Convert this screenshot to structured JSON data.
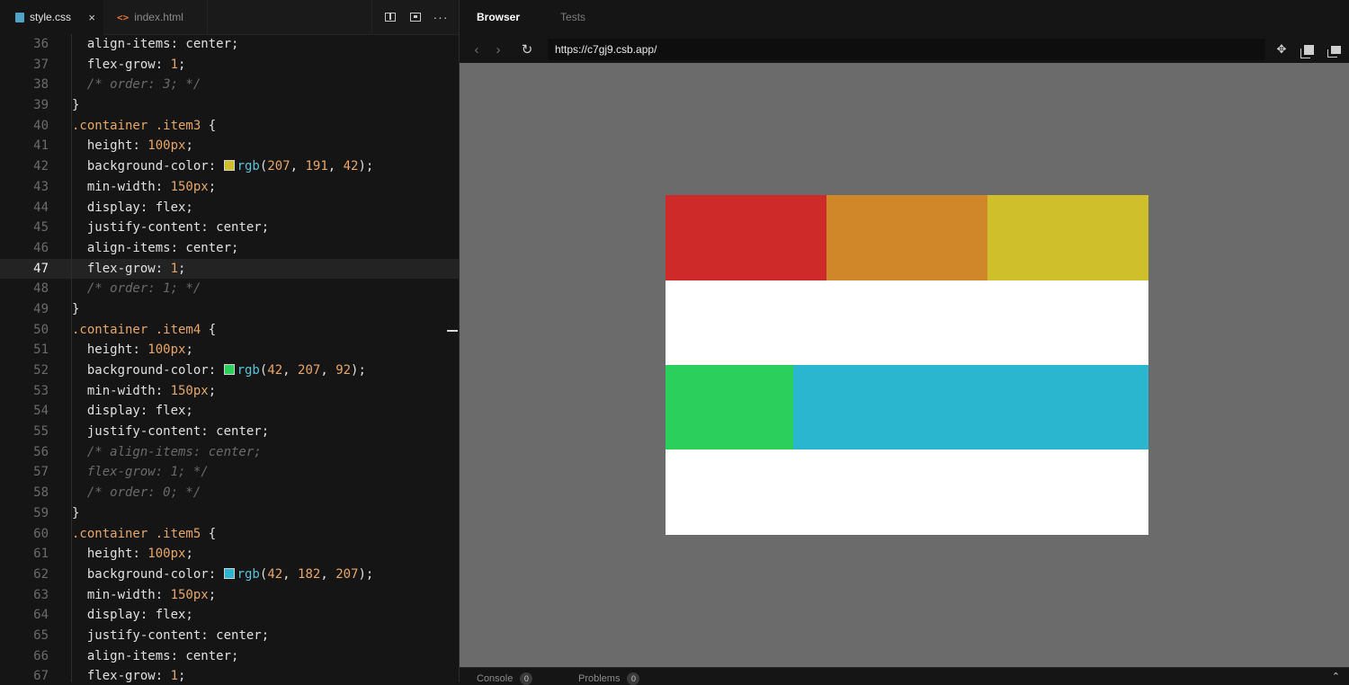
{
  "editor": {
    "tabs": [
      {
        "label": "style.css",
        "active": true,
        "icon": "css-file-icon"
      },
      {
        "label": "index.html",
        "active": false,
        "icon": "html-file-icon"
      }
    ],
    "close_glyph": "×",
    "html_icon_glyph": "<>",
    "more_glyph": "···",
    "current_line": 47,
    "lines": [
      {
        "n": "36",
        "segs": [
          [
            "p",
            "  align-items"
          ],
          [
            "k",
            ": center;"
          ]
        ]
      },
      {
        "n": "37",
        "segs": [
          [
            "p",
            "  flex-grow"
          ],
          [
            "k",
            ": "
          ],
          [
            "n",
            "1"
          ],
          [
            "k",
            ";"
          ]
        ]
      },
      {
        "n": "38",
        "segs": [
          [
            "c",
            "  /* order: 3; */"
          ]
        ]
      },
      {
        "n": "39",
        "segs": [
          [
            "k",
            "}"
          ]
        ]
      },
      {
        "n": "40",
        "segs": [
          [
            "s",
            ".container .item3"
          ],
          [
            "k",
            " {"
          ]
        ]
      },
      {
        "n": "41",
        "segs": [
          [
            "p",
            "  height"
          ],
          [
            "k",
            ": "
          ],
          [
            "n",
            "100px"
          ],
          [
            "k",
            ";"
          ]
        ]
      },
      {
        "n": "42",
        "segs": [
          [
            "p",
            "  background-color"
          ],
          [
            "k",
            ": "
          ],
          [
            "sw",
            "#cfbf2a"
          ],
          [
            "f",
            "rgb"
          ],
          [
            "k",
            "("
          ],
          [
            "n",
            "207"
          ],
          [
            "k",
            ", "
          ],
          [
            "n",
            "191"
          ],
          [
            "k",
            ", "
          ],
          [
            "n",
            "42"
          ],
          [
            "k",
            ");"
          ]
        ]
      },
      {
        "n": "43",
        "segs": [
          [
            "p",
            "  min-width"
          ],
          [
            "k",
            ": "
          ],
          [
            "n",
            "150px"
          ],
          [
            "k",
            ";"
          ]
        ]
      },
      {
        "n": "44",
        "segs": [
          [
            "p",
            "  display"
          ],
          [
            "k",
            ": flex;"
          ]
        ]
      },
      {
        "n": "45",
        "segs": [
          [
            "p",
            "  justify-content"
          ],
          [
            "k",
            ": center;"
          ]
        ]
      },
      {
        "n": "46",
        "segs": [
          [
            "p",
            "  align-items"
          ],
          [
            "k",
            ": center;"
          ]
        ]
      },
      {
        "n": "47",
        "segs": [
          [
            "p",
            "  flex-grow"
          ],
          [
            "k",
            ": "
          ],
          [
            "n",
            "1"
          ],
          [
            "k",
            ";"
          ]
        ]
      },
      {
        "n": "48",
        "segs": [
          [
            "c",
            "  /* order: 1; */"
          ]
        ]
      },
      {
        "n": "49",
        "segs": [
          [
            "k",
            "}"
          ]
        ]
      },
      {
        "n": "50",
        "segs": [
          [
            "s",
            ".container .item4"
          ],
          [
            "k",
            " {"
          ]
        ]
      },
      {
        "n": "51",
        "segs": [
          [
            "p",
            "  height"
          ],
          [
            "k",
            ": "
          ],
          [
            "n",
            "100px"
          ],
          [
            "k",
            ";"
          ]
        ]
      },
      {
        "n": "52",
        "segs": [
          [
            "p",
            "  background-color"
          ],
          [
            "k",
            ": "
          ],
          [
            "sw",
            "#2acf5c"
          ],
          [
            "f",
            "rgb"
          ],
          [
            "k",
            "("
          ],
          [
            "n",
            "42"
          ],
          [
            "k",
            ", "
          ],
          [
            "n",
            "207"
          ],
          [
            "k",
            ", "
          ],
          [
            "n",
            "92"
          ],
          [
            "k",
            ");"
          ]
        ]
      },
      {
        "n": "53",
        "segs": [
          [
            "p",
            "  min-width"
          ],
          [
            "k",
            ": "
          ],
          [
            "n",
            "150px"
          ],
          [
            "k",
            ";"
          ]
        ]
      },
      {
        "n": "54",
        "segs": [
          [
            "p",
            "  display"
          ],
          [
            "k",
            ": flex;"
          ]
        ]
      },
      {
        "n": "55",
        "segs": [
          [
            "p",
            "  justify-content"
          ],
          [
            "k",
            ": center;"
          ]
        ]
      },
      {
        "n": "56",
        "segs": [
          [
            "c",
            "  /* align-items: center;"
          ]
        ]
      },
      {
        "n": "57",
        "segs": [
          [
            "c",
            "  flex-grow: 1; */"
          ]
        ]
      },
      {
        "n": "58",
        "segs": [
          [
            "c",
            "  /* order: 0; */"
          ]
        ]
      },
      {
        "n": "59",
        "segs": [
          [
            "k",
            "}"
          ]
        ]
      },
      {
        "n": "60",
        "segs": [
          [
            "s",
            ".container .item5"
          ],
          [
            "k",
            " {"
          ]
        ]
      },
      {
        "n": "61",
        "segs": [
          [
            "p",
            "  height"
          ],
          [
            "k",
            ": "
          ],
          [
            "n",
            "100px"
          ],
          [
            "k",
            ";"
          ]
        ]
      },
      {
        "n": "62",
        "segs": [
          [
            "p",
            "  background-color"
          ],
          [
            "k",
            ": "
          ],
          [
            "sw",
            "#2ab6cf"
          ],
          [
            "f",
            "rgb"
          ],
          [
            "k",
            "("
          ],
          [
            "n",
            "42"
          ],
          [
            "k",
            ", "
          ],
          [
            "n",
            "182"
          ],
          [
            "k",
            ", "
          ],
          [
            "n",
            "207"
          ],
          [
            "k",
            ");"
          ]
        ]
      },
      {
        "n": "63",
        "segs": [
          [
            "p",
            "  min-width"
          ],
          [
            "k",
            ": "
          ],
          [
            "n",
            "150px"
          ],
          [
            "k",
            ";"
          ]
        ]
      },
      {
        "n": "64",
        "segs": [
          [
            "p",
            "  display"
          ],
          [
            "k",
            ": flex;"
          ]
        ]
      },
      {
        "n": "65",
        "segs": [
          [
            "p",
            "  justify-content"
          ],
          [
            "k",
            ": center;"
          ]
        ]
      },
      {
        "n": "66",
        "segs": [
          [
            "p",
            "  align-items"
          ],
          [
            "k",
            ": center;"
          ]
        ]
      },
      {
        "n": "67",
        "segs": [
          [
            "p",
            "  flex-grow"
          ],
          [
            "k",
            ": "
          ],
          [
            "n",
            "1"
          ],
          [
            "k",
            ";"
          ]
        ]
      }
    ]
  },
  "browser": {
    "tabs": {
      "browser": "Browser",
      "tests": "Tests"
    },
    "url": "https://c7gj9.csb.app/",
    "nav": {
      "back": "‹",
      "forward": "›",
      "reload": "↻"
    },
    "preview_blocks": [
      {
        "name": "item1-block",
        "color": "#cf2a2a"
      },
      {
        "name": "item2-block",
        "color": "#cf872a"
      },
      {
        "name": "item3-block",
        "color": "#cfbf2a"
      },
      {
        "name": "item4-block",
        "color": "#2acf5c"
      },
      {
        "name": "item5-block",
        "color": "#2ab6cf"
      }
    ]
  },
  "statusbar": {
    "console": "Console",
    "console_count": "0",
    "problems": "Problems",
    "problems_count": "0",
    "chevron": "⌃"
  }
}
